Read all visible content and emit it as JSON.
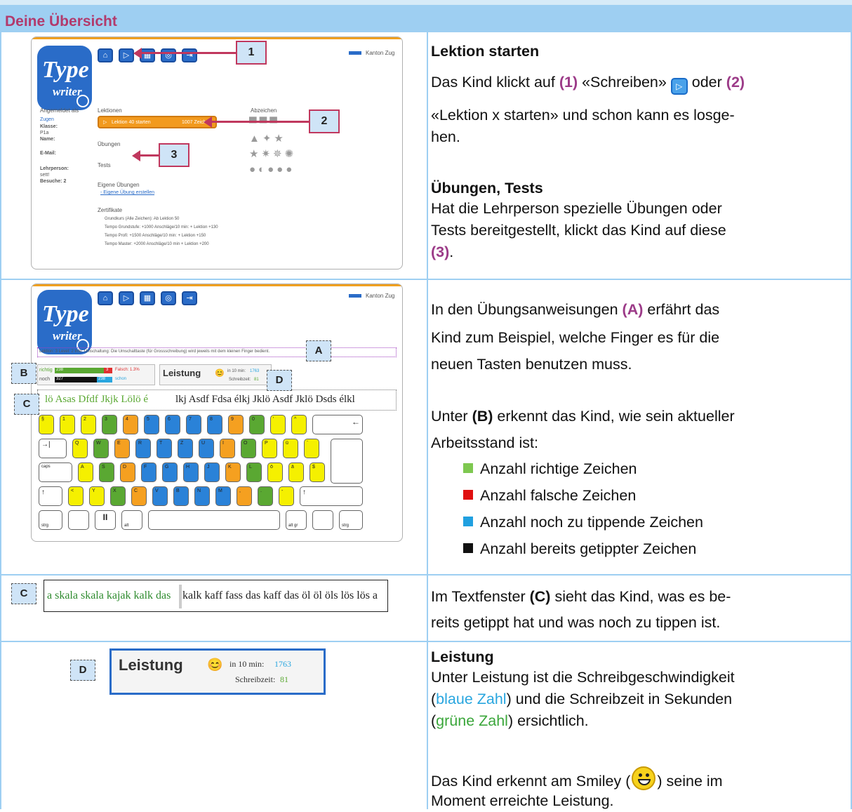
{
  "header": {
    "title": "Deine Übersicht"
  },
  "row1": {
    "screenshot": {
      "logo_line1": "Type",
      "logo_line2": "writer",
      "toolbar_labels": [
        "Übersicht",
        "Schreiben",
        "Katalog",
        "Hilfe",
        "Abmelden"
      ],
      "kanton": "Kanton Zug",
      "login_heading": "Angemeldet als",
      "user": "Zugen",
      "klasse_label": "Klasse:",
      "klasse_value": "P1a",
      "name_label": "Name:",
      "email_label": "E-Mail:",
      "lehrperson_label": "Lehrperson:",
      "lehrperson_value": "sett!",
      "besuche_label": "Besuche: 2",
      "lektionen_heading": "Lektionen",
      "lektion_start": "Lektion 40 starten",
      "lektion_count": "1007 Zeichen",
      "uebungen": "Übungen",
      "tests": "Tests",
      "eigene_heading": "Eigene Übungen",
      "eigene_link": "- Eigene Übung erstellen",
      "abzeichen_heading": "Abzeichen",
      "zertifikate_heading": "Zertifikate",
      "zertifikate": [
        "Grundkurs (Alle Zeichen): Ab Lektion 50",
        "Tempo Grundstufe: +1000 Anschläge/10 min: + Lektion +130",
        "Tempo Profi: +1500 Anschläge/10 min: + Lektion +150",
        "Tempo Master: +2000 Anschläge/10 min + Lektion +200"
      ]
    },
    "callouts": [
      "1",
      "2",
      "3"
    ],
    "heading1": "Lektion starten",
    "p1_a": "Das Kind klickt auf ",
    "p1_n1": "(1)",
    "p1_b": " «Schreiben» ",
    "p1_c": " oder ",
    "p1_n2": "(2)",
    "p1_line2": "«Lektion x starten» und schon kann es losge-",
    "p1_line3": "hen.",
    "heading2": "Übungen, Tests",
    "p2_line1": "Hat die Lehrperson spezielle Übungen oder",
    "p2_line2": "Tests bereitgestellt, klickt das Kind auf diese",
    "p2_n3": "(3)",
    "p2_end": "."
  },
  "row2": {
    "screenshot": {
      "kanton": "Kanton Zug",
      "info": "Lektion: 3  Level: 2  Info: Umschaltung: Die Umschalttaste (für Grossschreibung) wird jeweils mit dem kleinen Finger bedient.",
      "richtig_label": "richtig",
      "richtig_value": "238",
      "falsch_value": "3",
      "falsch_label": "Falsch: 1.3%",
      "noch_label": "noch",
      "noch_value": "327",
      "getippt_value": "238",
      "schon_label": "schon",
      "leistung": "Leistung",
      "in10": "in 10 min:",
      "in10_value": "1763",
      "schreibzeit": "Schreibzeit:",
      "schreibzeit_value": "81",
      "typeline": "lö Asas Dfdf Jkjk Lölö élkj Asdf Fdsa élkj Jklö Asdf Jklö Dsds élkl",
      "keys_row1": [
        "§",
        "1",
        "2",
        "3",
        "4",
        "5",
        "6",
        "7",
        "8",
        "9",
        "0",
        "'",
        "^",
        "←"
      ],
      "keys_row2": [
        "→|",
        "Q",
        "W",
        "E",
        "R",
        "T",
        "Z",
        "U",
        "I",
        "O",
        "P",
        "ü",
        "¨"
      ],
      "keys_row3": [
        "caps",
        "A",
        "S",
        "D",
        "F",
        "G",
        "H",
        "J",
        "K",
        "L",
        "ö",
        "ä",
        "$"
      ],
      "keys_row4": [
        "↑",
        "<",
        "Y",
        "X",
        "C",
        "V",
        "B",
        "N",
        "M",
        ",",
        ".",
        "-",
        "↑"
      ],
      "keys_row5": [
        "strg",
        "",
        "alt",
        "",
        "alt gr",
        "",
        "strg"
      ]
    },
    "labels": [
      "A",
      "B",
      "C",
      "D"
    ],
    "p1_a": "In den Übungsanweisungen ",
    "p1_A": "(A)",
    "p1_b": " erfährt das",
    "p1_line2": "Kind zum Beispiel, welche Finger es für die",
    "p1_line3": "neuen Tasten benutzen muss.",
    "p2_a": "Unter ",
    "p2_B": "(B)",
    "p2_b": " erkennt das Kind, wie sein aktueller",
    "p2_line2": "Arbeitsstand ist:",
    "bullets": [
      "Anzahl richtige Zeichen",
      "Anzahl falsche Zeichen",
      "Anzahl noch zu tippende Zeichen",
      "Anzahl bereits getippter Zeichen"
    ],
    "bullet_colors": [
      "#7ec850",
      "#e01010",
      "#20a0e0",
      "#111111"
    ]
  },
  "row3": {
    "label": "C",
    "typed": "a skala skala kajak kalk das ",
    "pending": "kalk kaff fass das kaff das öl öl öls lös lös a",
    "p_a": "Im Textfenster ",
    "p_C": "(C)",
    "p_b": " sieht das Kind, was es be-",
    "p_line2": "reits getippt hat und was noch zu tippen ist."
  },
  "row4": {
    "label": "D",
    "leistung": "Leistung",
    "in10": "in 10 min:",
    "in10_value": "1763",
    "schreibzeit": "Schreibzeit:",
    "schreibzeit_value": "81",
    "heading": "Leistung",
    "line1": "Unter Leistung ist die Schreibgeschwindigkeit",
    "line2_a": "(",
    "line2_blue": "blaue Zahl",
    "line2_b": ") und die Schreibzeit in Sekunden",
    "line3_a": "(",
    "line3_green": "grüne Zahl",
    "line3_b": ") ersichtlich.",
    "line4_a": "Das Kind erkennt am Smiley (",
    "line4_b": ") seine im",
    "line5": "Moment erreichte Leistung."
  }
}
